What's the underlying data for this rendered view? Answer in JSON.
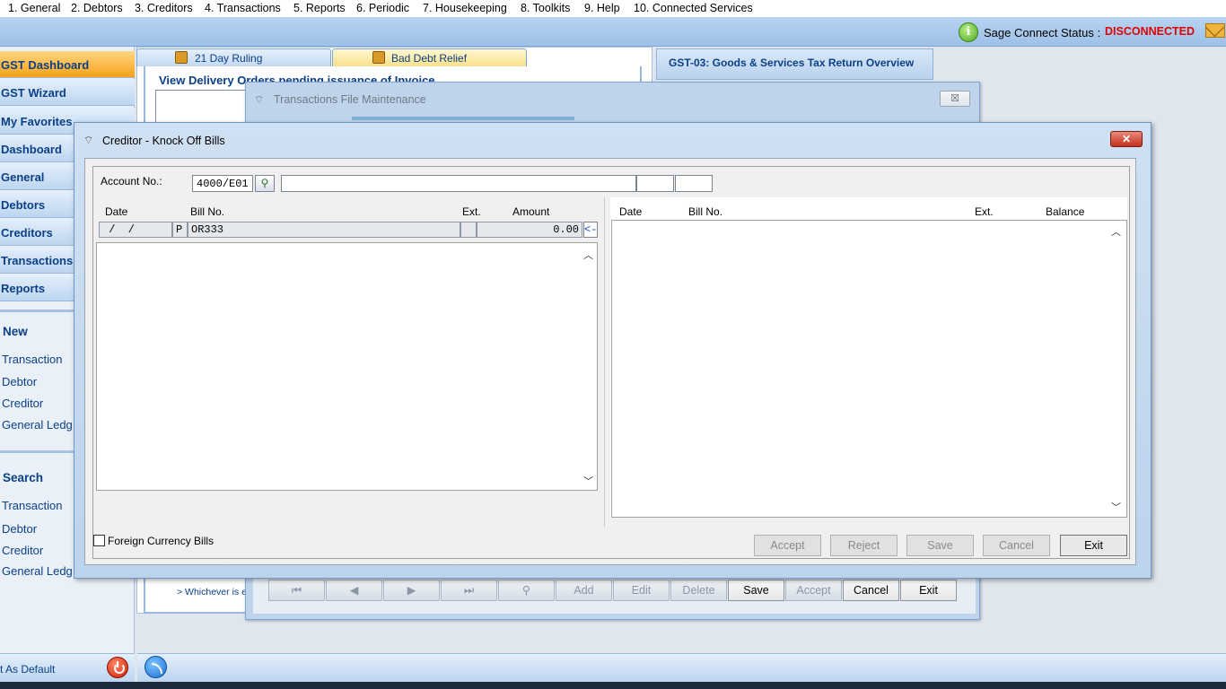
{
  "menu": [
    "1. General",
    "2. Debtors",
    "3. Creditors",
    "4. Transactions",
    "5. Reports",
    "6. Periodic",
    "7. Housekeeping",
    "8. Toolkits",
    "9. Help",
    "10. Connected Services"
  ],
  "status": {
    "label": "Sage Connect Status :",
    "value": "DISCONNECTED",
    "info_icon": "info-icon",
    "mail_icon": "mail-icon",
    "value_color": "#e00000"
  },
  "sidebar": {
    "items": [
      "GST Dashboard",
      "GST Wizard",
      "My Favorites",
      "Dashboard",
      "General",
      "Debtors",
      "Creditors",
      "Transactions",
      "Reports"
    ],
    "new_heading": "New",
    "new_links": [
      "Transaction",
      "Debtor",
      "Creditor",
      "General Ledg"
    ],
    "search_heading": "Search",
    "search_links": [
      "Transaction",
      "Debtor",
      "Creditor",
      "General Ledg"
    ],
    "set_default": "t As Default"
  },
  "tabs": [
    "21 Day Ruling",
    "Bad Debt Relief"
  ],
  "background": {
    "view_delivery": "View Delivery Orders pending issuance of Invoice",
    "gst_title": "GST-03: Goods & Services Tax Return Overview",
    "whichever": "> Whichever is e"
  },
  "tfm": {
    "title": "Transactions File Maintenance",
    "close": "☒",
    "buttons": [
      "",
      "",
      "",
      "",
      "",
      "Add",
      "Edit",
      "Delete",
      "Save",
      "Accept",
      "Cancel",
      "Exit"
    ]
  },
  "dialog": {
    "title": "Creditor - Knock Off Bills",
    "close": "✕",
    "account_label": "Account No.:",
    "account_value": "4000/E01",
    "left_headers": {
      "date": "Date",
      "bill": "Bill No.",
      "ext": "Ext.",
      "amount": "Amount"
    },
    "entry": {
      "date": " /  /",
      "type": "P",
      "bill": "OR333",
      "ext": "",
      "amount": "0.00",
      "arrow": "<-"
    },
    "right_headers": {
      "date": "Date",
      "bill": "Bill No.",
      "ext": "Ext.",
      "balance": "Balance"
    },
    "foreign_currency": "Foreign Currency Bills",
    "buttons": {
      "accept": "Accept",
      "reject": "Reject",
      "save": "Save",
      "cancel": "Cancel",
      "exit": "Exit"
    }
  }
}
